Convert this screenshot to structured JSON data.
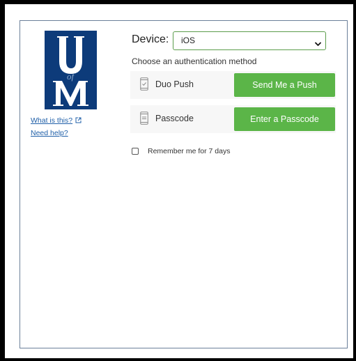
{
  "logo": {
    "letter_top": "U",
    "letter_mid": "of",
    "letter_bottom": "M"
  },
  "links": {
    "what_is_this": "What is this?",
    "need_help": "Need help?"
  },
  "device": {
    "label": "Device:",
    "selected": "iOS"
  },
  "auth": {
    "prompt": "Choose an authentication method",
    "methods": [
      {
        "label": "Duo Push",
        "button": "Send Me a Push",
        "icon": "phone-check-icon"
      },
      {
        "label": "Passcode",
        "button": "Enter a Passcode",
        "icon": "phone-passcode-icon"
      }
    ]
  },
  "remember": {
    "label": "Remember me for 7 days",
    "checked": false
  },
  "colors": {
    "brand_blue": "#0d3b7a",
    "button_green": "#5bb548",
    "select_border": "#5a9c4a",
    "link_blue": "#1f5fa8"
  }
}
